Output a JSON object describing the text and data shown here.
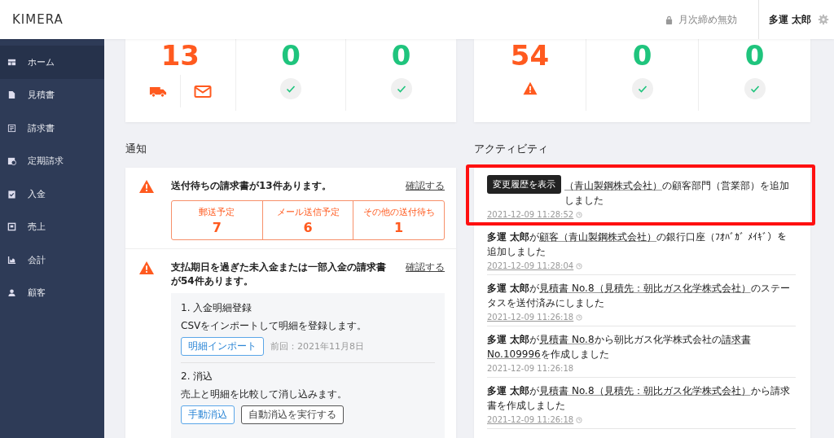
{
  "header": {
    "logo": "KIMERA",
    "closing_status": "月次締め無効",
    "user_name": "多運 太郎"
  },
  "sidebar": {
    "items": [
      {
        "label": "ホーム",
        "selected": true
      },
      {
        "label": "見積書",
        "selected": false
      },
      {
        "label": "請求書",
        "selected": false
      },
      {
        "label": "定期請求",
        "selected": false
      },
      {
        "label": "入金",
        "selected": false
      },
      {
        "label": "売上",
        "selected": false
      },
      {
        "label": "会計",
        "selected": false
      },
      {
        "label": "顧客",
        "selected": false
      }
    ]
  },
  "summary_cards": [
    {
      "stats": [
        {
          "value": "13",
          "kind": "delivery"
        },
        {
          "value": "0",
          "kind": "ok"
        },
        {
          "value": "0",
          "kind": "ok"
        }
      ]
    },
    {
      "stats": [
        {
          "value": "54",
          "kind": "warning"
        },
        {
          "value": "0",
          "kind": "ok"
        },
        {
          "value": "0",
          "kind": "ok"
        }
      ]
    }
  ],
  "notifications": {
    "title": "通知",
    "items": [
      {
        "kind": "breakdown",
        "message": "送付待ちの請求書が13件あります。",
        "link": "確認する",
        "breakdown": [
          {
            "label": "郵送予定",
            "value": "7"
          },
          {
            "label": "メール送信予定",
            "value": "6"
          },
          {
            "label": "その他の送付待ち",
            "value": "1"
          }
        ]
      },
      {
        "kind": "steps",
        "message": "支払期日を過ぎた未入金または一部入金の請求書が54件あります。",
        "link": "確認する",
        "steps": [
          {
            "title": "1. 入金明細登録",
            "description": "CSVをインポートして明細を登録します。",
            "buttons": [
              {
                "label": "明細インポート",
                "kind": "primary"
              }
            ],
            "note": "前回：2021年11月8日"
          },
          {
            "title": "2. 消込",
            "description": "売上と明細を比較して消し込みます。",
            "buttons": [
              {
                "label": "手動消込",
                "kind": "primary"
              },
              {
                "label": "自動消込を実行する",
                "kind": "secondary"
              }
            ]
          }
        ]
      }
    ]
  },
  "activity": {
    "title": "アクティビティ",
    "items": [
      {
        "highlighted": true,
        "tooltip": "変更履歴を表示",
        "segments": [
          {
            "text": "（青山製鋼株式会社）",
            "kind": "link"
          },
          {
            "text": "の顧客部門（営業部）を追加しました",
            "kind": "plain"
          }
        ],
        "time": "2021-12-09 11:28:52",
        "has_history": true
      },
      {
        "highlighted": false,
        "segments": [
          {
            "text": "多運 太郎",
            "kind": "bold"
          },
          {
            "text": "が",
            "kind": "plain"
          },
          {
            "text": "顧客（青山製鋼株式会社）",
            "kind": "link"
          },
          {
            "text": "の銀行口座（ﾌｵﾊﾞｶﾞ ﾒｲｷﾞ）を追加しました",
            "kind": "plain"
          }
        ],
        "time": "2021-12-09 11:28:04",
        "has_history": true
      },
      {
        "highlighted": false,
        "segments": [
          {
            "text": "多運 太郎",
            "kind": "bold"
          },
          {
            "text": "が",
            "kind": "plain"
          },
          {
            "text": "見積書 No.8（見積先：朝比ガス化学株式会社）",
            "kind": "link"
          },
          {
            "text": "のステータスを送付済みにしました",
            "kind": "plain"
          }
        ],
        "time": "2021-12-09 11:26:18",
        "has_history": true
      },
      {
        "highlighted": false,
        "segments": [
          {
            "text": "多運 太郎",
            "kind": "bold"
          },
          {
            "text": "が",
            "kind": "plain"
          },
          {
            "text": "見積書 No.8",
            "kind": "link"
          },
          {
            "text": "から朝比ガス化学株式会社の",
            "kind": "plain"
          },
          {
            "text": "請求書 No.109996",
            "kind": "link"
          },
          {
            "text": "を作成しました",
            "kind": "plain"
          }
        ],
        "time": "2021-12-09 11:26:18",
        "has_history": false
      },
      {
        "highlighted": false,
        "segments": [
          {
            "text": "多運 太郎",
            "kind": "bold"
          },
          {
            "text": "が",
            "kind": "plain"
          },
          {
            "text": "見積書 No.8（見積先：朝比ガス化学株式会社）",
            "kind": "link"
          },
          {
            "text": "から請求書を作成しました",
            "kind": "plain"
          }
        ],
        "time": "2021-12-09 11:26:18",
        "has_history": true
      }
    ]
  }
}
